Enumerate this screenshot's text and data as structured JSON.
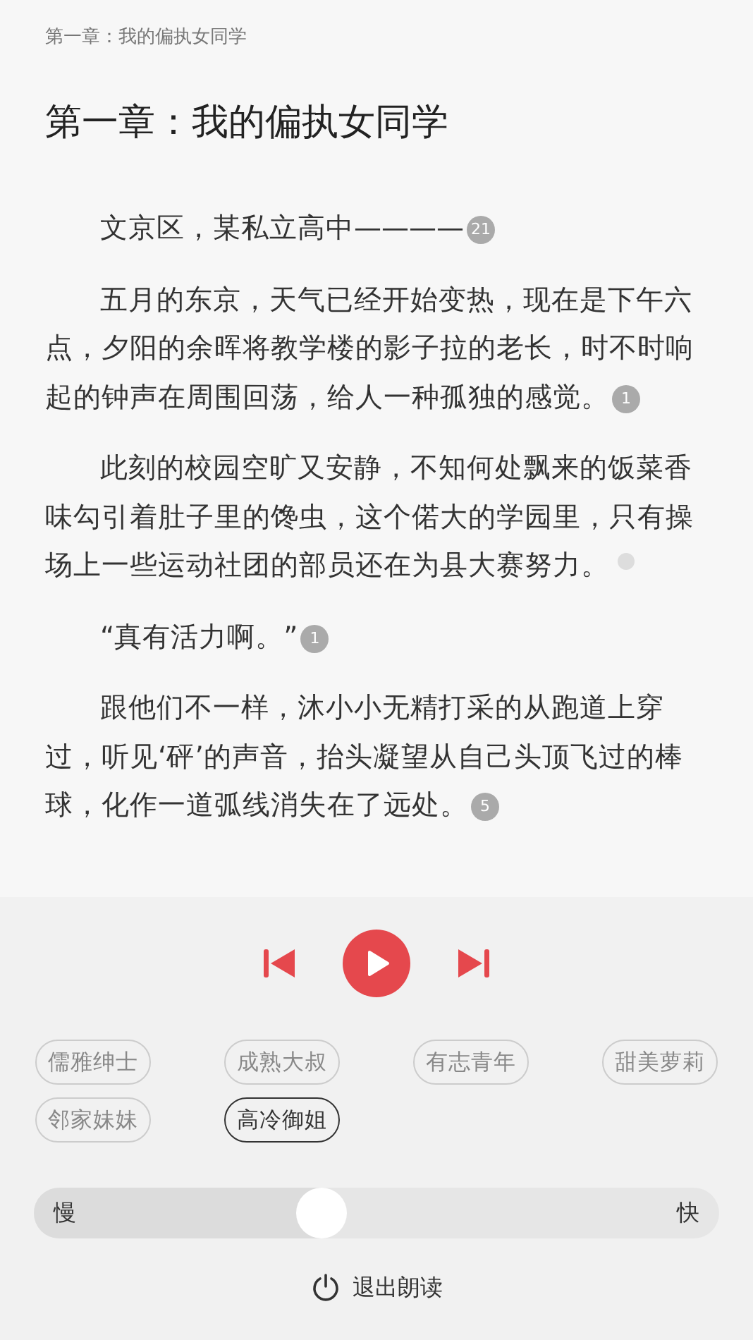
{
  "header": {
    "chapter": "第一章：我的偏执女同学"
  },
  "chapter_title": "第一章：我的偏执女同学",
  "paragraphs": [
    {
      "text": "文京区，某私立高中————",
      "comments": "21"
    },
    {
      "text": "五月的东京，天气已经开始变热，现在是下午六点，夕阳的余晖将教学楼的影子拉的老长，时不时响起的钟声在周围回荡，给人一种孤独的感觉。",
      "comments": "1"
    },
    {
      "text": "此刻的校园空旷又安静，不知何处飘来的饭菜香味勾引着肚子里的馋虫，这个偌大的学园里，只有操场上一些运动社团的部员还在为县大赛努力。"
    },
    {
      "text": "“真有活力啊。”",
      "comments": "1"
    },
    {
      "text": "跟他们不一样，沐小小无精打采的从跑道上穿过，听见‘砰’的声音，抬头凝望从自己头顶飞过的棒球，化作一道弧线消失在了远处。",
      "comments": "5"
    }
  ],
  "player": {
    "playing": false
  },
  "voices": [
    {
      "label": "儒雅绅士",
      "selected": false
    },
    {
      "label": "成熟大叔",
      "selected": false
    },
    {
      "label": "有志青年",
      "selected": false
    },
    {
      "label": "甜美萝莉",
      "selected": false
    },
    {
      "label": "邻家妹妹",
      "selected": false
    },
    {
      "label": "高冷御姐",
      "selected": true
    }
  ],
  "speed": {
    "slow_label": "慢",
    "fast_label": "快",
    "level": 0.42
  },
  "exit_button": {
    "label": "退出朗读"
  }
}
